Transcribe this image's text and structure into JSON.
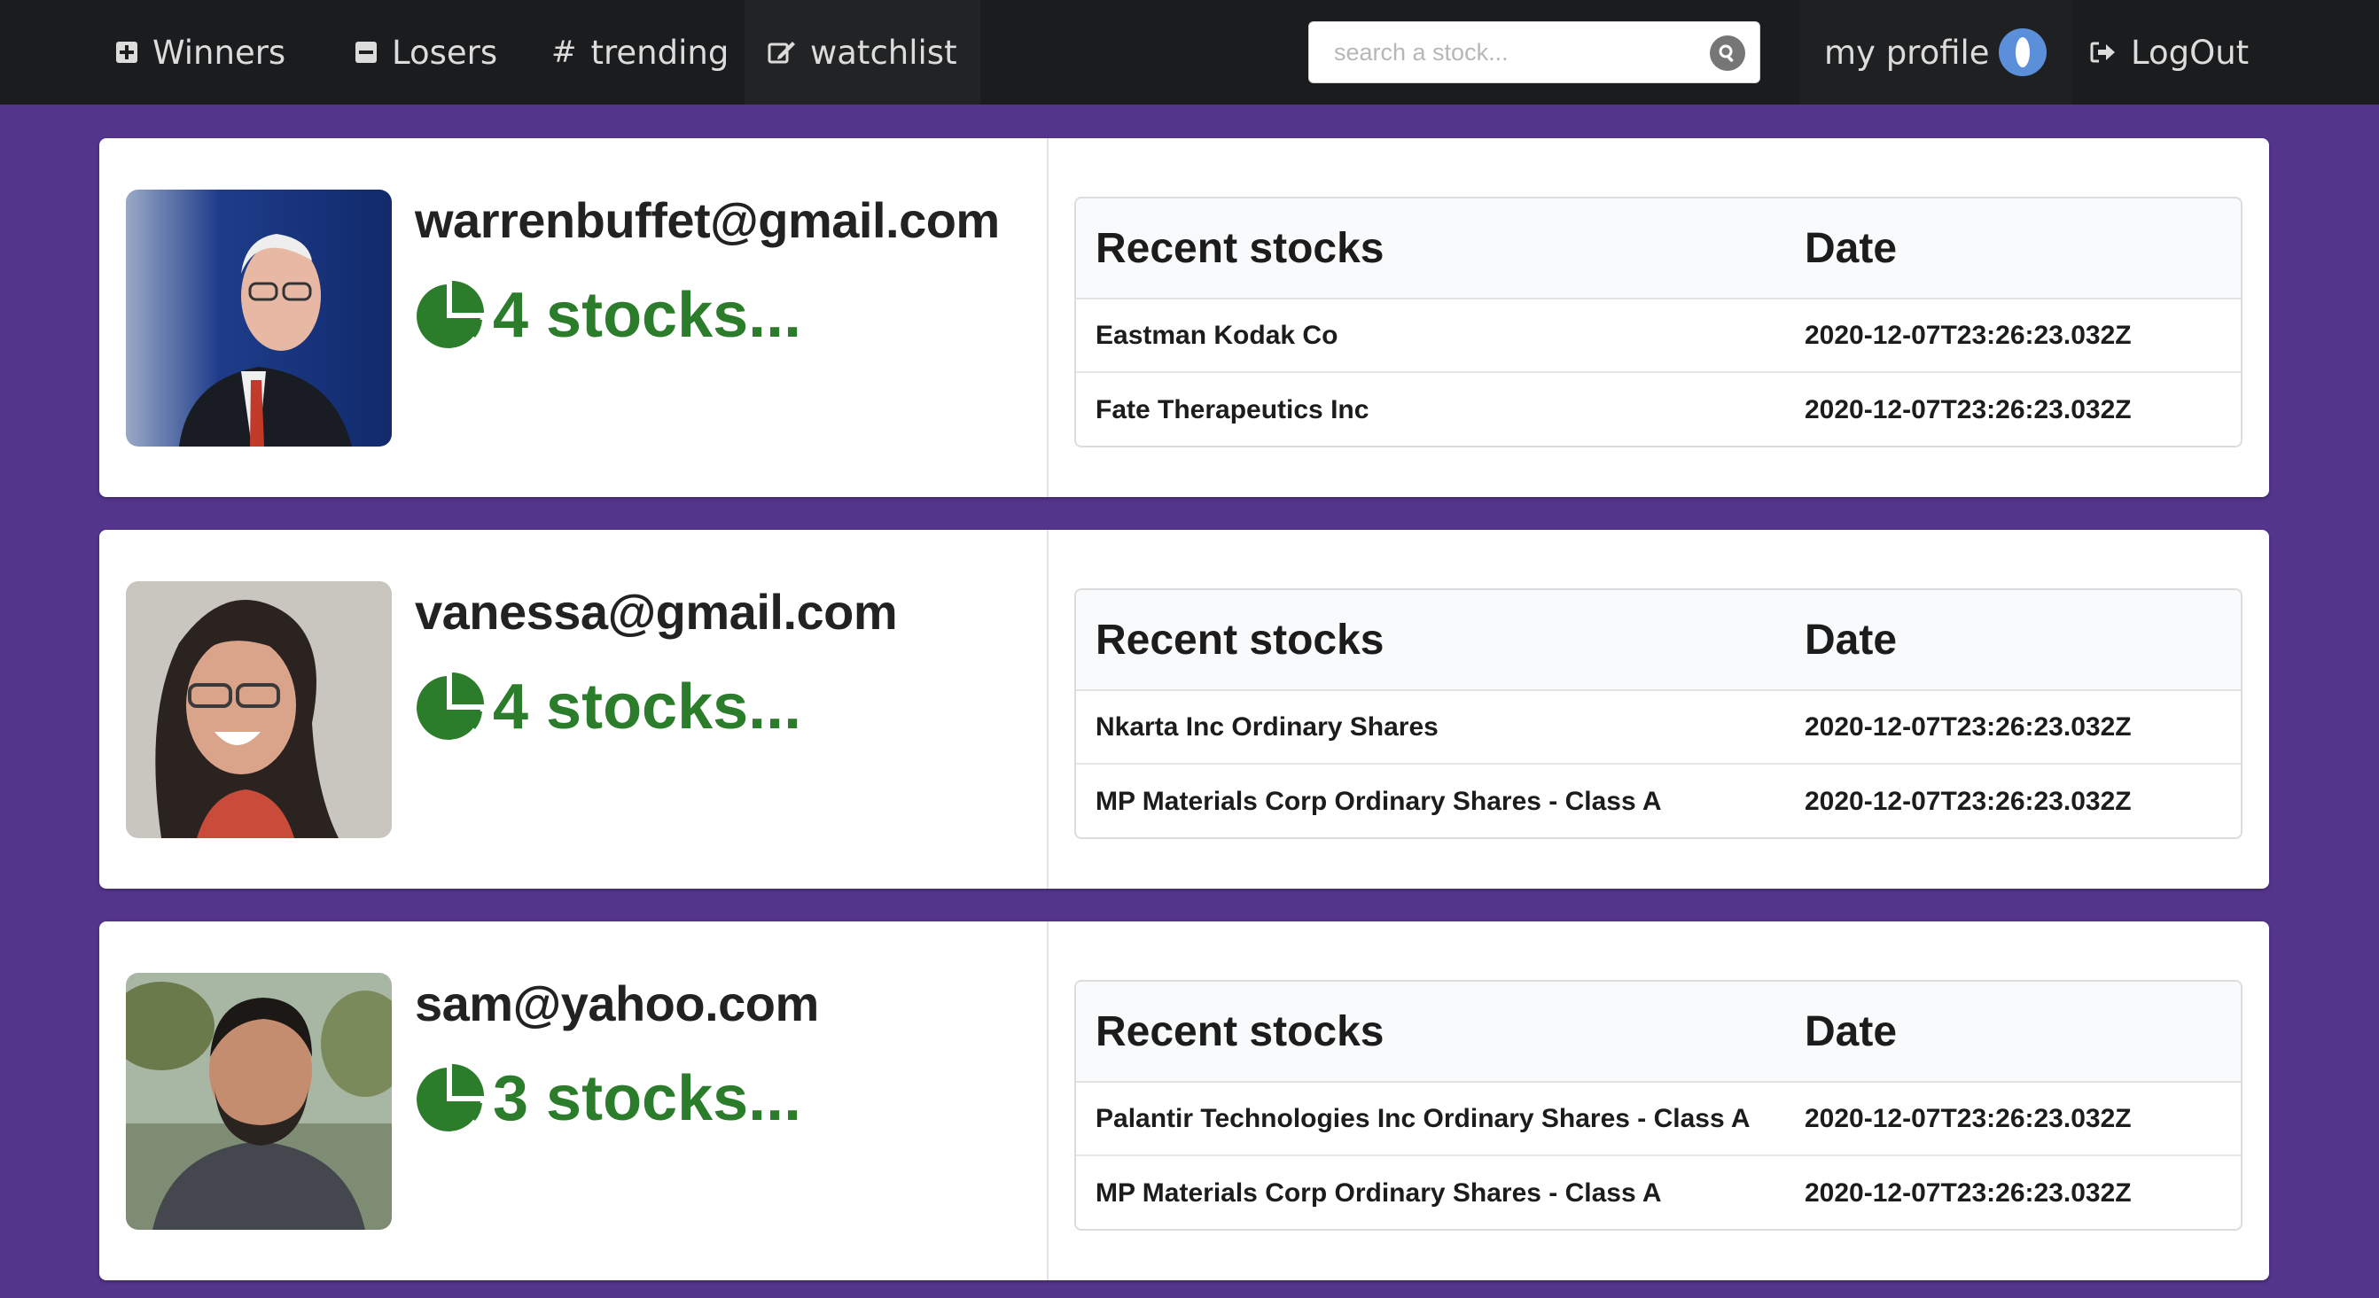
{
  "nav": {
    "winners": "Winners",
    "losers": "Losers",
    "trending": "trending",
    "watchlist": "watchlist",
    "search_placeholder": "search a stock...",
    "profile": "my profile",
    "logout": "LogOut"
  },
  "colors": {
    "background": "#54358c",
    "navbar": "#1b1c1d",
    "stock_count": "#2b7d2b",
    "toggle": "#5b8fd9"
  },
  "table_headers": {
    "stock": "Recent stocks",
    "date": "Date"
  },
  "users": [
    {
      "email": "warrenbuffet@gmail.com",
      "stock_count": "4 stocks...",
      "recent": [
        {
          "name": "Eastman Kodak Co",
          "date": "2020-12-07T23:26:23.032Z"
        },
        {
          "name": "Fate Therapeutics Inc",
          "date": "2020-12-07T23:26:23.032Z"
        }
      ]
    },
    {
      "email": "vanessa@gmail.com",
      "stock_count": "4 stocks...",
      "recent": [
        {
          "name": "Nkarta Inc Ordinary Shares",
          "date": "2020-12-07T23:26:23.032Z"
        },
        {
          "name": "MP Materials Corp Ordinary Shares - Class A",
          "date": "2020-12-07T23:26:23.032Z"
        }
      ]
    },
    {
      "email": "sam@yahoo.com",
      "stock_count": "3 stocks...",
      "recent": [
        {
          "name": "Palantir Technologies Inc Ordinary Shares - Class A",
          "date": "2020-12-07T23:26:23.032Z"
        },
        {
          "name": "MP Materials Corp Ordinary Shares - Class A",
          "date": "2020-12-07T23:26:23.032Z"
        }
      ]
    }
  ]
}
